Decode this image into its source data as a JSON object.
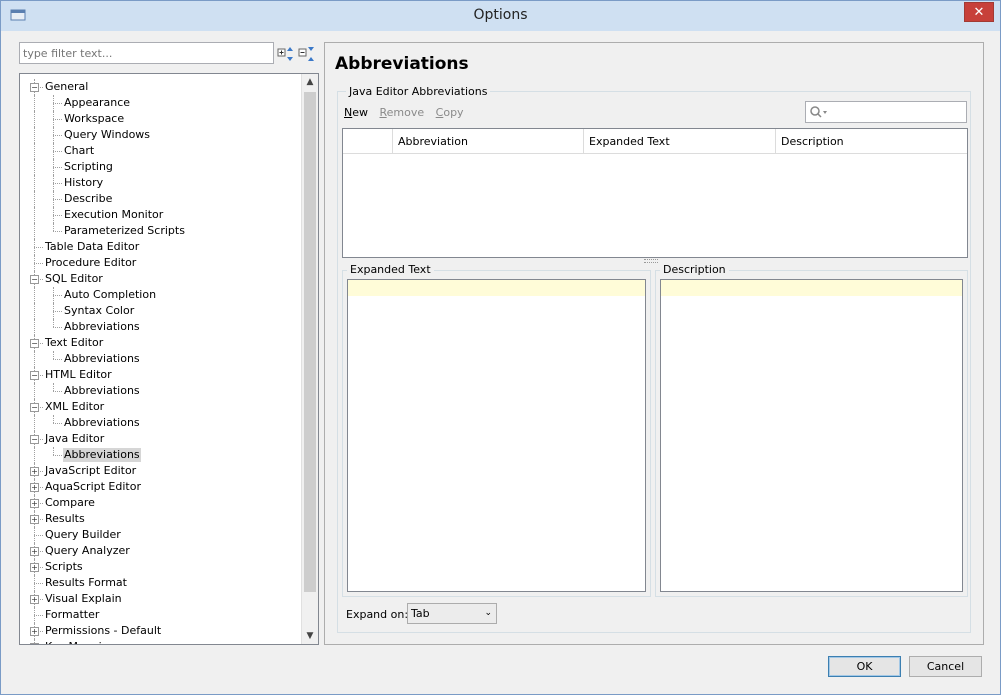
{
  "window": {
    "title": "Options",
    "close_glyph": "✕"
  },
  "filter": {
    "placeholder": "type filter text..."
  },
  "tree": {
    "items": [
      {
        "label": "General",
        "level": 0,
        "expander": "−"
      },
      {
        "label": "Appearance",
        "level": 1
      },
      {
        "label": "Workspace",
        "level": 1
      },
      {
        "label": "Query Windows",
        "level": 1
      },
      {
        "label": "Chart",
        "level": 1
      },
      {
        "label": "Scripting",
        "level": 1
      },
      {
        "label": "History",
        "level": 1
      },
      {
        "label": "Describe",
        "level": 1
      },
      {
        "label": "Execution Monitor",
        "level": 1
      },
      {
        "label": "Parameterized Scripts",
        "level": 1
      },
      {
        "label": "Table Data Editor",
        "level": 0
      },
      {
        "label": "Procedure Editor",
        "level": 0
      },
      {
        "label": "SQL Editor",
        "level": 0,
        "expander": "−"
      },
      {
        "label": "Auto Completion",
        "level": 1
      },
      {
        "label": "Syntax Color",
        "level": 1
      },
      {
        "label": "Abbreviations",
        "level": 1
      },
      {
        "label": "Text Editor",
        "level": 0,
        "expander": "−"
      },
      {
        "label": "Abbreviations",
        "level": 1
      },
      {
        "label": "HTML Editor",
        "level": 0,
        "expander": "−"
      },
      {
        "label": "Abbreviations",
        "level": 1
      },
      {
        "label": "XML Editor",
        "level": 0,
        "expander": "−"
      },
      {
        "label": "Abbreviations",
        "level": 1
      },
      {
        "label": "Java Editor",
        "level": 0,
        "expander": "−"
      },
      {
        "label": "Abbreviations",
        "level": 1,
        "selected": true
      },
      {
        "label": "JavaScript Editor",
        "level": 0,
        "expander": "+"
      },
      {
        "label": "AquaScript Editor",
        "level": 0,
        "expander": "+"
      },
      {
        "label": "Compare",
        "level": 0,
        "expander": "+"
      },
      {
        "label": "Results",
        "level": 0,
        "expander": "+"
      },
      {
        "label": "Query Builder",
        "level": 0
      },
      {
        "label": "Query Analyzer",
        "level": 0,
        "expander": "+"
      },
      {
        "label": "Scripts",
        "level": 0,
        "expander": "+"
      },
      {
        "label": "Results Format",
        "level": 0
      },
      {
        "label": "Visual Explain",
        "level": 0,
        "expander": "+"
      },
      {
        "label": "Formatter",
        "level": 0
      },
      {
        "label": "Permissions - Default",
        "level": 0,
        "expander": "+"
      },
      {
        "label": "Key Mappings",
        "level": 0,
        "expander": "+"
      }
    ],
    "scroll_up": "▲",
    "scroll_down": "▼"
  },
  "main": {
    "title": "Abbreviations",
    "group_label": "Java Editor Abbreviations",
    "toolbar": {
      "new": "New",
      "new_mnemonic": "N",
      "new_rest": "ew",
      "remove": "Remove",
      "remove_mnemonic": "R",
      "remove_rest": "emove",
      "copy": "Copy",
      "copy_mnemonic": "C",
      "copy_rest": "opy"
    },
    "table": {
      "columns": [
        "",
        "Abbreviation",
        "Expanded Text",
        "Description"
      ]
    },
    "expanded_text_label": "Expanded Text",
    "description_label": "Description",
    "expand_on_label": "Expand on:",
    "expand_on_value": "Tab"
  },
  "buttons": {
    "ok": "OK",
    "cancel": "Cancel"
  }
}
